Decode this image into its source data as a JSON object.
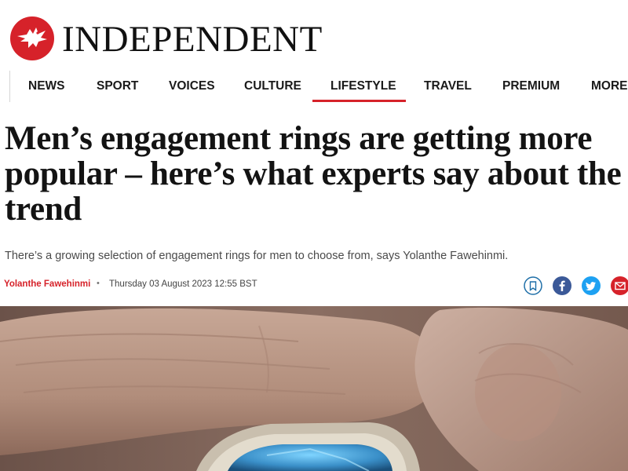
{
  "brand": {
    "name": "INDEPENDENT",
    "logo_icon": "eagle-icon",
    "accent_color": "#d6222a"
  },
  "nav": {
    "items": [
      {
        "label": "NEWS"
      },
      {
        "label": "SPORT"
      },
      {
        "label": "VOICES"
      },
      {
        "label": "CULTURE"
      },
      {
        "label": "LIFESTYLE",
        "active": true
      },
      {
        "label": "TRAVEL"
      },
      {
        "label": "PREMIUM"
      },
      {
        "label": "MORE"
      }
    ]
  },
  "article": {
    "headline": "Men’s engagement rings are getting more popular – here’s what experts say about the trend",
    "standfirst": "There’s a growing selection of engagement rings for men to choose from, says Yolanthe Fawehinmi.",
    "author": "Yolanthe Fawehinmi",
    "date": "Thursday 03 August 2023 12:55 BST"
  },
  "share": {
    "buttons": [
      {
        "icon": "bookmark-icon",
        "color": "#1f6fa8"
      },
      {
        "icon": "facebook-icon",
        "color": "#3b5998"
      },
      {
        "icon": "twitter-icon",
        "color": "#1da1f2"
      },
      {
        "icon": "email-icon",
        "color": "#d6222a"
      }
    ]
  },
  "hero_image": {
    "subject": "ring-photo"
  }
}
